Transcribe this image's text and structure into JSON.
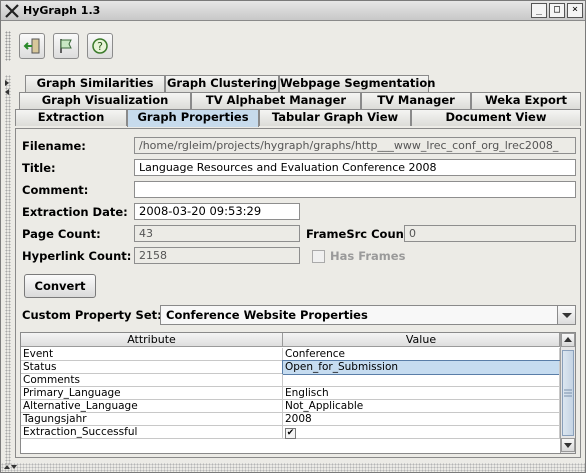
{
  "window": {
    "title": "HyGraph 1.3",
    "min_label": "_",
    "max_label": "□",
    "close_label": "×"
  },
  "toolbar": {
    "icons": [
      "exit-icon",
      "flag-icon",
      "help-icon"
    ]
  },
  "tabs": {
    "row1": [
      "Graph Similarities",
      "Graph Clustering",
      "Webpage Segmentation"
    ],
    "row2": [
      "Graph Visualization",
      "TV Alphabet Manager",
      "TV Manager",
      "Weka Export"
    ],
    "row3": [
      "Extraction",
      "Graph Properties",
      "Tabular Graph View",
      "Document View"
    ],
    "active": "Graph Properties"
  },
  "form": {
    "filename_label": "Filename:",
    "filename_value": "/home/rgleim/projects/hygraph/graphs/http___www_lrec_conf_org_lrec2008_",
    "title_label": "Title:",
    "title_value": "Language Resources and Evaluation Conference 2008",
    "comment_label": "Comment:",
    "comment_value": "",
    "extraction_date_label": "Extraction Date:",
    "extraction_date_value": "2008-03-20 09:53:29",
    "page_count_label": "Page Count:",
    "page_count_value": "43",
    "framesrc_label": "FrameSrc Count:",
    "framesrc_value": "0",
    "hyperlink_label": "Hyperlink Count:",
    "hyperlink_value": "2158",
    "has_frames_label": "Has Frames",
    "convert_label": "Convert",
    "custom_set_label": "Custom Property Set:",
    "custom_set_value": "Conference Website Properties"
  },
  "table": {
    "headers": [
      "Attribute",
      "Value"
    ],
    "rows": [
      {
        "attr": "Event",
        "value": "Conference"
      },
      {
        "attr": "Status",
        "value": "Open_for_Submission"
      },
      {
        "attr": "Comments",
        "value": ""
      },
      {
        "attr": "Primary_Language",
        "value": "Englisch"
      },
      {
        "attr": "Alternative_Language",
        "value": "Not_Applicable"
      },
      {
        "attr": "Tagungsjahr",
        "value": "2008"
      },
      {
        "attr": "Extraction_Successful",
        "value": "✔"
      }
    ]
  }
}
